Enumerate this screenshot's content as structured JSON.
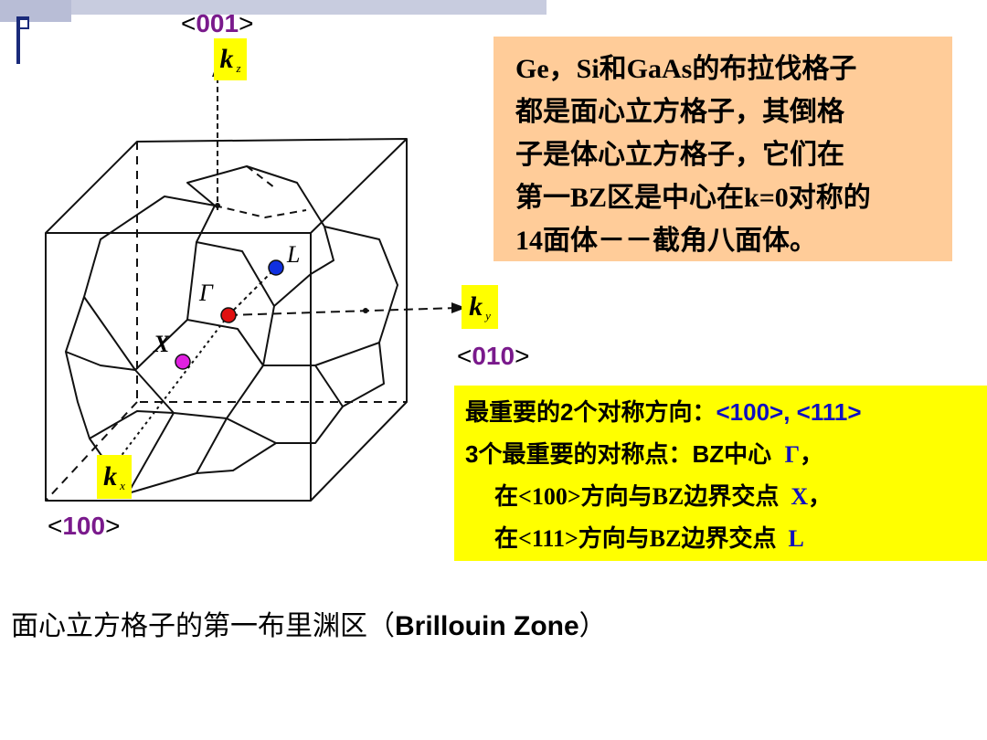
{
  "slide": {
    "accent_color": "#1a2a7a",
    "bar_color": "#b8bdd6"
  },
  "diagram": {
    "axis_labels": {
      "z_dir": {
        "open": "<",
        "num": "001",
        "close": ">"
      },
      "y_dir": {
        "open": "<",
        "num": "010",
        "close": ">"
      },
      "x_dir": {
        "open": "<",
        "num": "100",
        "close": ">"
      },
      "kz": {
        "k": "k",
        "sub": "z"
      },
      "ky": {
        "k": "k",
        "sub": "y"
      },
      "kx": {
        "k": "k",
        "sub": "x"
      }
    },
    "points": {
      "L": {
        "label": "L",
        "color": "#1030e0"
      },
      "Gamma": {
        "label": "Γ",
        "color": "#e01010"
      },
      "X": {
        "label": "X",
        "color": "#e020e0"
      }
    }
  },
  "info_box": {
    "lines": [
      "Ge，Si和GaAs的布拉伐格子",
      "都是面心立方格子，其倒格",
      "子是体心立方格子，它们在",
      "第一BZ区是中心在k=0对称的",
      "14面体－－截角八面体。"
    ]
  },
  "symmetry_box": {
    "line1": {
      "text": "最重要的2个对称方向：",
      "highlight": "<100>, <111>"
    },
    "line2": {
      "text": "3个最重要的对称点：BZ中心",
      "symbol": "Γ",
      "tail": "，"
    },
    "line3": {
      "text": "在<100>方向与BZ边界交点",
      "symbol": "X",
      "tail": "，"
    },
    "line4": {
      "text": "在<111>方向与BZ边界交点",
      "symbol": "L",
      "tail": ""
    }
  },
  "caption": {
    "cn": "面心立方格子的第一布里渊区（",
    "en": "Brillouin Zone",
    "close": "）"
  }
}
